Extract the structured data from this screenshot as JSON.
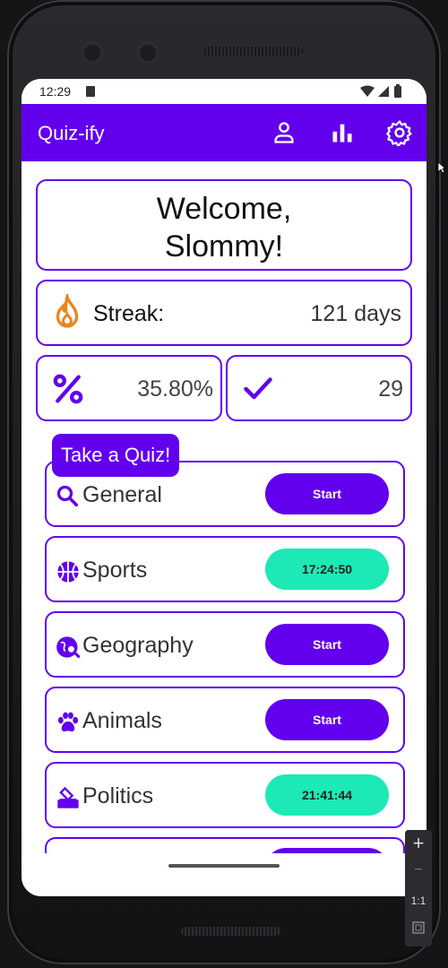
{
  "status_bar": {
    "time": "12:29"
  },
  "app_bar": {
    "title": "Quiz-ify",
    "icons": [
      "person-icon",
      "bar-chart-icon",
      "settings-icon"
    ]
  },
  "welcome": {
    "text": "Welcome,\nSlommy!"
  },
  "streak": {
    "label": "Streak:",
    "value": "121 days",
    "icon": "flame-icon"
  },
  "stats": {
    "percent": {
      "icon": "percent-icon",
      "value": "35.80%"
    },
    "correct": {
      "icon": "check-icon",
      "value": "29"
    }
  },
  "quiz_section": {
    "label": "Take a Quiz!"
  },
  "quizzes": [
    {
      "name": "General",
      "icon": "search-icon",
      "button": "Start",
      "state": "start"
    },
    {
      "name": "Sports",
      "icon": "basketball-icon",
      "button": "17:24:50",
      "state": "timer"
    },
    {
      "name": "Geography",
      "icon": "globe-search-icon",
      "button": "Start",
      "state": "start"
    },
    {
      "name": "Animals",
      "icon": "paw-icon",
      "button": "Start",
      "state": "start"
    },
    {
      "name": "Politics",
      "icon": "ballot-icon",
      "button": "21:41:44",
      "state": "timer"
    }
  ],
  "emulator": {
    "zoom_in": "+",
    "zoom_out": "−",
    "ratio": "1:1"
  },
  "colors": {
    "primary": "#6200ee",
    "timer": "#1de9b6",
    "flame": "#e8871e"
  }
}
